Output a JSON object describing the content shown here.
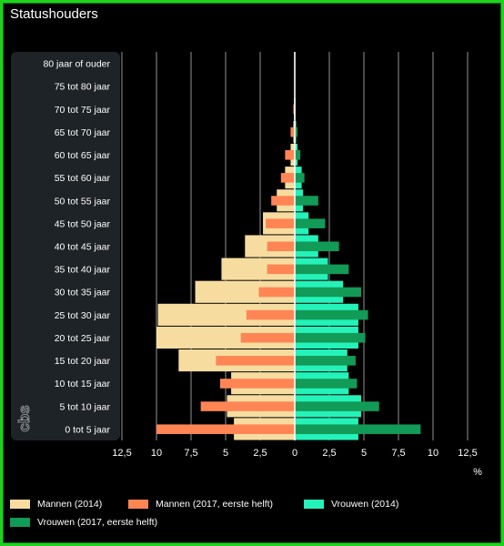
{
  "title": "Statushouders",
  "unit_label": "%",
  "colors": {
    "mannen_2014": "#f7dca0",
    "mannen_2017": "#ff8555",
    "vrouwen_2014": "#24f2b9",
    "vrouwen_2017": "#129a57",
    "label_panel": "#1d2327"
  },
  "logo_text": "cbs",
  "chart_data": {
    "type": "bar",
    "orientation": "horizontal-population-pyramid",
    "categories": [
      "80 jaar of ouder",
      "75 tot 80 jaar",
      "70 tot 75 jaar",
      "65 tot 70 jaar",
      "60 tot 65 jaar",
      "55 tot 60 jaar",
      "50 tot 55 jaar",
      "45 tot 50 jaar",
      "40 tot 45 jaar",
      "35 tot 40 jaar",
      "30 tot 35 jaar",
      "25 tot 30 jaar",
      "20 tot 25 jaar",
      "15 tot 20 jaar",
      "10 tot 15 jaar",
      "5 tot 10 jaar",
      "0 tot 5 jaar"
    ],
    "series": [
      {
        "name": "Mannen (2014)",
        "side": "left",
        "values": [
          0,
          0,
          0.05,
          0.1,
          0.3,
          0.7,
          1.3,
          2.3,
          3.6,
          5.3,
          7.2,
          9.9,
          10.0,
          8.4,
          4.6,
          4.9,
          4.4
        ]
      },
      {
        "name": "Mannen (2017, eerste helft)",
        "side": "left",
        "values": [
          0,
          0,
          0.1,
          0.3,
          0.7,
          1.0,
          1.7,
          2.1,
          2.0,
          2.0,
          2.6,
          3.5,
          3.9,
          5.7,
          5.4,
          6.8,
          10.0
        ]
      },
      {
        "name": "Vrouwen (2014)",
        "side": "right",
        "values": [
          0,
          0,
          0.05,
          0.1,
          0.2,
          0.5,
          0.6,
          1.0,
          1.7,
          2.4,
          3.5,
          4.6,
          4.6,
          3.8,
          3.9,
          4.8,
          4.6
        ]
      },
      {
        "name": "Vrouwen (2017, eerste helft)",
        "side": "right",
        "values": [
          0,
          0,
          0.05,
          0.2,
          0.4,
          0.7,
          1.7,
          2.2,
          3.2,
          3.9,
          4.8,
          5.3,
          5.1,
          4.4,
          4.5,
          6.1,
          9.1
        ]
      }
    ],
    "x_ticks": [
      "12,5",
      "10",
      "7,5",
      "5",
      "2,5",
      "0",
      "2,5",
      "5",
      "7,5",
      "10",
      "12,5"
    ],
    "xlim": [
      -12.5,
      12.5
    ],
    "grid": true,
    "legend_position": "bottom"
  }
}
